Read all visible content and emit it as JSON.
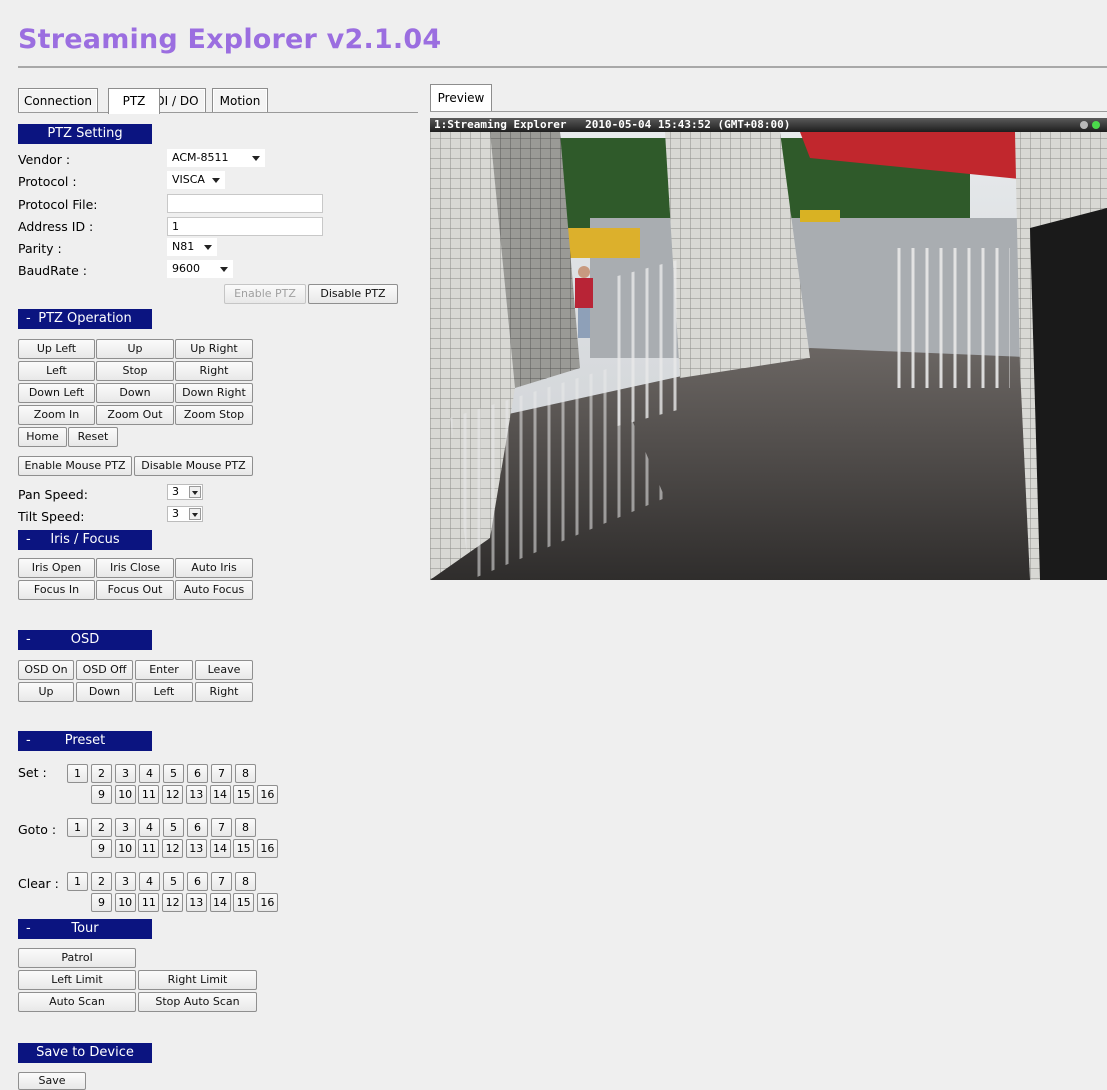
{
  "app": {
    "title": "Streaming Explorer v2.1.04"
  },
  "tabs": [
    {
      "label": "Connection"
    },
    {
      "label": "PTZ"
    },
    {
      "label": "DI / DO"
    },
    {
      "label": "Motion"
    }
  ],
  "ptz_setting": {
    "header": "PTZ Setting",
    "vendor_label": "Vendor :",
    "vendor_value": "ACM-8511",
    "protocol_label": "Protocol :",
    "protocol_value": "VISCA",
    "protocol_file_label": "Protocol File:",
    "protocol_file_value": "",
    "address_label": "Address ID :",
    "address_value": "1",
    "parity_label": "Parity :",
    "parity_value": "N81",
    "baud_label": "BaudRate :",
    "baud_value": "9600",
    "enable_ptz": "Enable PTZ",
    "disable_ptz": "Disable PTZ"
  },
  "ptz_operation": {
    "dash": "-",
    "header": "PTZ Operation",
    "up_left": "Up Left",
    "up": "Up",
    "up_right": "Up Right",
    "left": "Left",
    "stop": "Stop",
    "right": "Right",
    "down_left": "Down Left",
    "down": "Down",
    "down_right": "Down Right",
    "zoom_in": "Zoom In",
    "zoom_out": "Zoom Out",
    "zoom_stop": "Zoom Stop",
    "home": "Home",
    "reset": "Reset",
    "enable_mouse": "Enable Mouse PTZ",
    "disable_mouse": "Disable Mouse PTZ",
    "pan_label": "Pan Speed:",
    "pan_value": "3",
    "tilt_label": "Tilt Speed:",
    "tilt_value": "3"
  },
  "iris_focus": {
    "dash": "-",
    "header": "Iris / Focus",
    "iris_open": "Iris Open",
    "iris_close": "Iris Close",
    "auto_iris": "Auto Iris",
    "focus_in": "Focus In",
    "focus_out": "Focus Out",
    "auto_focus": "Auto Focus"
  },
  "osd": {
    "dash": "-",
    "header": "OSD",
    "osd_on": "OSD On",
    "osd_off": "OSD Off",
    "enter": "Enter",
    "leave": "Leave",
    "up": "Up",
    "down": "Down",
    "left": "Left",
    "right": "Right"
  },
  "preset": {
    "dash": "-",
    "header": "Preset",
    "set_label": "Set :",
    "goto_label": "Goto :",
    "clear_label": "Clear :",
    "numbers": [
      "1",
      "2",
      "3",
      "4",
      "5",
      "6",
      "7",
      "8",
      "9",
      "10",
      "11",
      "12",
      "13",
      "14",
      "15",
      "16"
    ]
  },
  "tour": {
    "dash": "-",
    "header": "Tour",
    "patrol": "Patrol",
    "left_limit": "Left Limit",
    "right_limit": "Right Limit",
    "auto_scan": "Auto Scan",
    "stop_auto_scan": "Stop Auto Scan"
  },
  "save": {
    "header": "Save to Device",
    "button": "Save"
  },
  "preview": {
    "tab": "Preview",
    "camera_name": "1:Streaming Explorer",
    "timestamp": "2010-05-04 15:43:52 (GMT+08:00)",
    "status_colors": [
      "#b9b9b9",
      "#4bd84b"
    ]
  }
}
